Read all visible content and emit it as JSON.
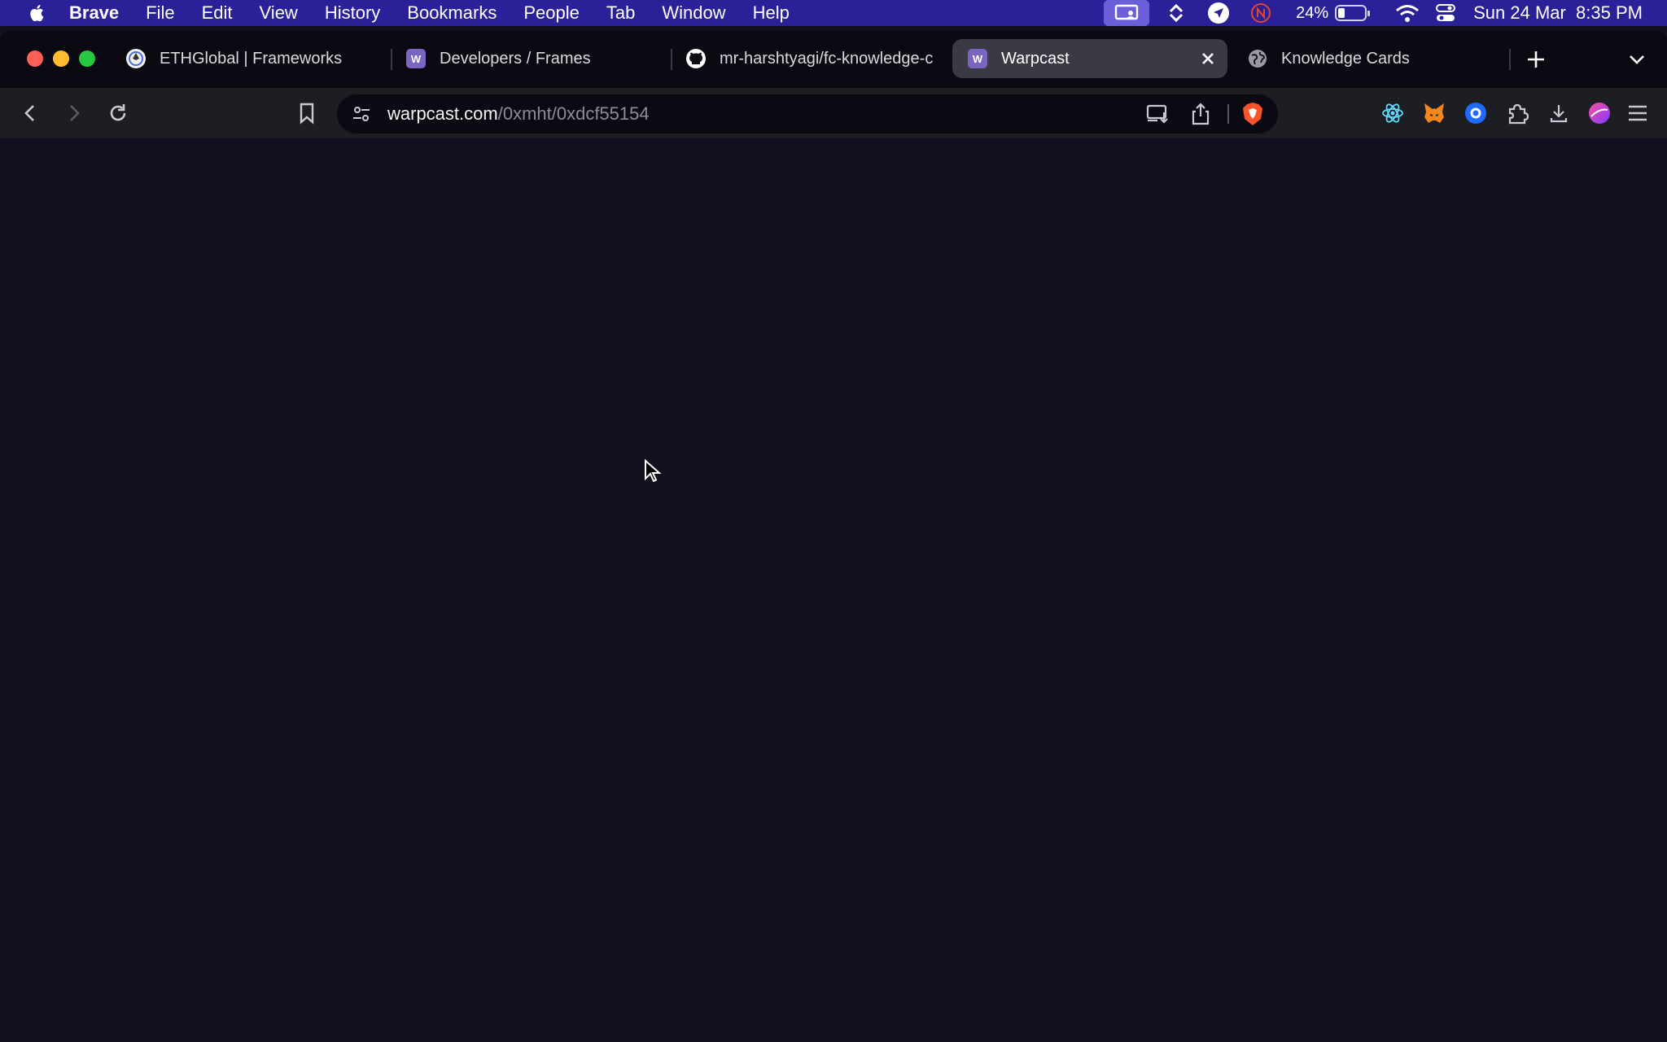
{
  "menubar": {
    "app_name": "Brave",
    "items": [
      "File",
      "Edit",
      "View",
      "History",
      "Bookmarks",
      "People",
      "Tab",
      "Window",
      "Help"
    ],
    "battery_percent": "24%",
    "datetime": "Sun 24 Mar  8:35 PM",
    "bar_color": "#2a2198"
  },
  "tabs": [
    {
      "title": "ETHGlobal | Frameworks",
      "favicon": "ethglobal-icon"
    },
    {
      "title": "Developers / Frames",
      "favicon": "warpcast-icon"
    },
    {
      "title": "mr-harshtyagi/fc-knowledge-c",
      "favicon": "github-icon"
    },
    {
      "title": "Warpcast",
      "favicon": "warpcast-icon",
      "active": true
    },
    {
      "title": "Knowledge Cards",
      "favicon": "globe-icon"
    }
  ],
  "address_bar": {
    "host": "warpcast.com",
    "path": "/0xmht/0xdcf55154"
  },
  "colors": {
    "page_background": "#120f1e",
    "brave_orange": "#fb542b",
    "warpcast_purple": "#7c65c1"
  }
}
